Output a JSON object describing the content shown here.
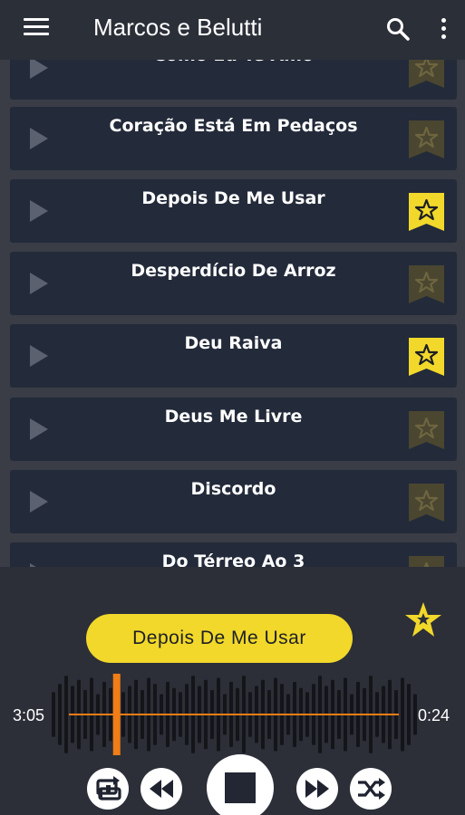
{
  "app": {
    "title": "Marcos e Belutti"
  },
  "icons": {
    "menu": "menu-icon",
    "search": "search-icon",
    "more": "more-vertical-icon"
  },
  "colors": {
    "accent": "#f1d82a",
    "card": "#232a3a",
    "appbar": "#2b2f38",
    "progress": "#f07d16"
  },
  "songs": [
    {
      "title": "Como Eu Te Amo",
      "favorite": false
    },
    {
      "title": "Coração Está Em Pedaços",
      "favorite": false
    },
    {
      "title": "Depois De Me Usar",
      "favorite": true
    },
    {
      "title": "Desperdício De Arroz",
      "favorite": false
    },
    {
      "title": "Deu Raiva",
      "favorite": true
    },
    {
      "title": "Deus Me Livre",
      "favorite": false
    },
    {
      "title": "Discordo",
      "favorite": false
    },
    {
      "title": "Do Térreo Ao 3",
      "favorite": false
    }
  ],
  "player": {
    "now_playing": "Depois De Me Usar",
    "elapsed": "3:05",
    "remaining": "0:24",
    "progress_fraction": 0.18,
    "controls": [
      "repeat-icon",
      "rewind-icon",
      "stop-icon",
      "fast-forward-icon",
      "shuffle-icon"
    ]
  }
}
